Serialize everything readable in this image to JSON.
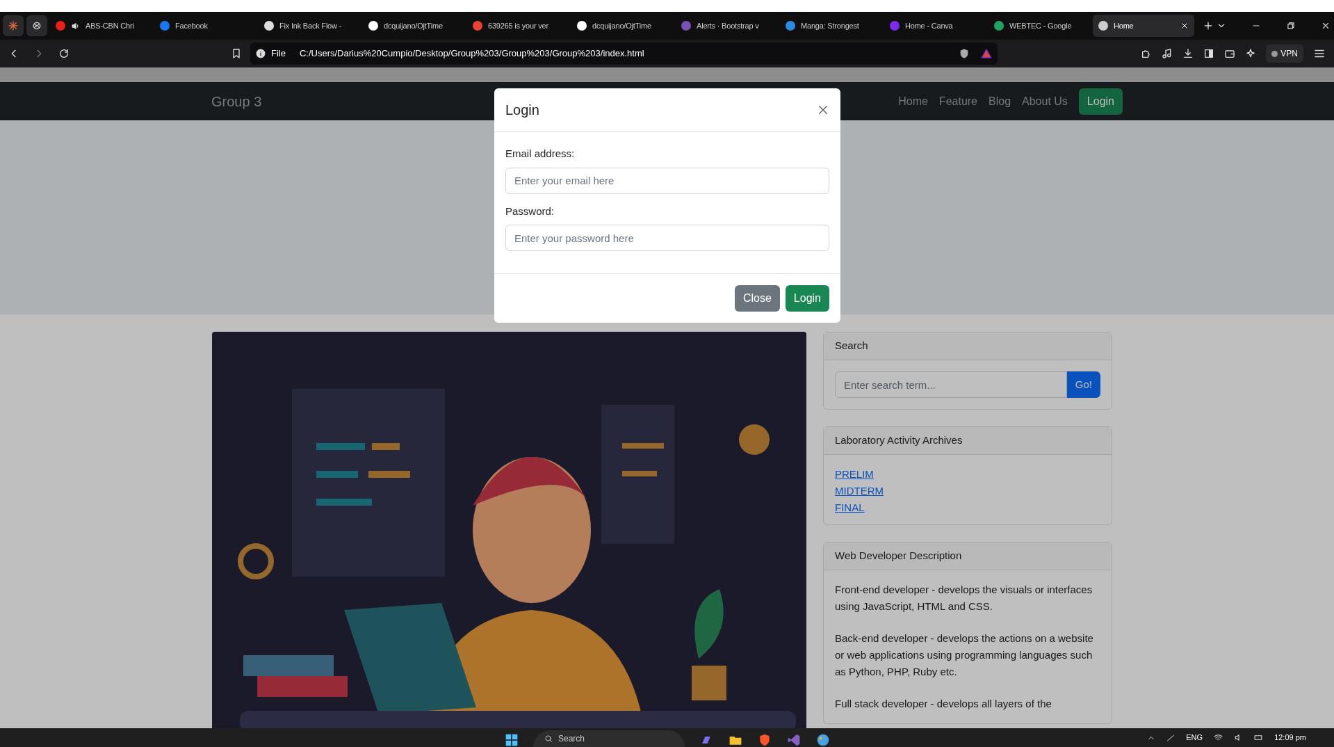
{
  "browser": {
    "tabs": [
      {
        "label": "ABS-CBN Chri",
        "audio": true,
        "selected": false
      },
      {
        "label": "Facebook",
        "audio": false,
        "selected": false
      },
      {
        "label": "Fix Ink Back Flow -",
        "audio": false,
        "selected": false
      },
      {
        "label": "dcquijano/OjtTime",
        "audio": false,
        "selected": false
      },
      {
        "label": "639265 is your ver",
        "audio": false,
        "selected": false
      },
      {
        "label": "dcquijano/OjtTime",
        "audio": false,
        "selected": false
      },
      {
        "label": "Alerts · Bootstrap v",
        "audio": false,
        "selected": false
      },
      {
        "label": "Manga: Strongest",
        "audio": false,
        "selected": false
      },
      {
        "label": "Home - Canva",
        "audio": false,
        "selected": false
      },
      {
        "label": "WEBTEC - Google",
        "audio": false,
        "selected": false
      },
      {
        "label": "Home",
        "audio": false,
        "selected": true
      }
    ],
    "address": {
      "scheme": "File",
      "url": "C:/Users/Darius%20Cumpio/Desktop/Group%203/Group%203/Group%203/index.html"
    },
    "vpn": "VPN"
  },
  "page": {
    "brand": "Group 3",
    "nav": [
      {
        "label": "Home",
        "kind": "link"
      },
      {
        "label": "Feature",
        "kind": "link"
      },
      {
        "label": "Blog",
        "kind": "link"
      },
      {
        "label": "About Us",
        "kind": "link"
      },
      {
        "label": "Login",
        "kind": "button"
      }
    ],
    "search_card": {
      "title": "Search",
      "placeholder": "Enter search term...",
      "button": "Go!"
    },
    "archives_card": {
      "title": "Laboratory Activity Archives",
      "links": [
        "PRELIM",
        "MIDTERM",
        "FINAL"
      ]
    },
    "description_card": {
      "title": "Web Developer Description",
      "paragraphs": [
        "Front-end developer - develops the visuals or interfaces using JavaScript, HTML and CSS.",
        "Back-end developer - develops the actions on a website or web applications using programming languages such as Python, PHP, Ruby etc.",
        "Full stack developer - develops all layers of the"
      ]
    }
  },
  "modal": {
    "title": "Login",
    "fields": [
      {
        "label": "Email address:",
        "placeholder": "Enter your email here"
      },
      {
        "label": "Password:",
        "placeholder": "Enter your password here"
      }
    ],
    "buttons": [
      {
        "label": "Close",
        "kind": "secondary"
      },
      {
        "label": "Login",
        "kind": "primary"
      }
    ]
  },
  "taskbar": {
    "search": "Search",
    "language": "ENG",
    "time": "12:09 pm"
  }
}
